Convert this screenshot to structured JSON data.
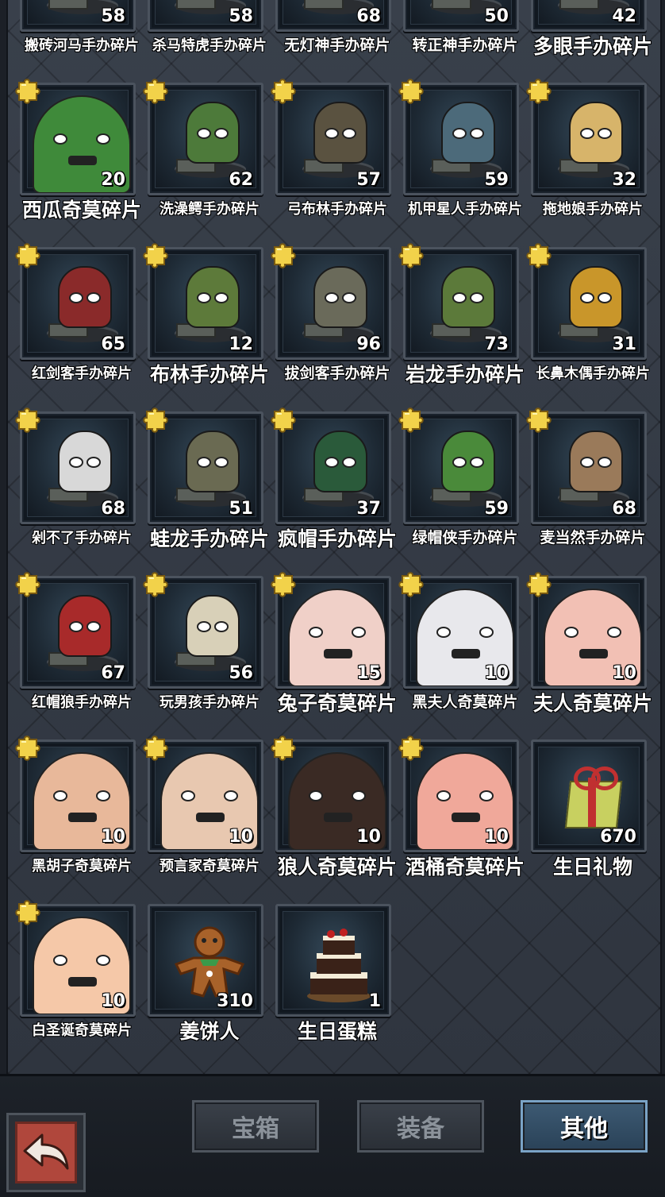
{
  "items": [
    {
      "label": "搬砖河马手办碎片",
      "count": "58",
      "puzzle": false,
      "type": "figure",
      "color": "#6a5a48",
      "size": "small"
    },
    {
      "label": "杀马特虎手办碎片",
      "count": "58",
      "puzzle": false,
      "type": "figure",
      "color": "#8b7d6a",
      "size": "small"
    },
    {
      "label": "无灯神手办碎片",
      "count": "68",
      "puzzle": false,
      "type": "figure",
      "color": "#4a6a8a",
      "size": "normal"
    },
    {
      "label": "转正神手办碎片",
      "count": "50",
      "puzzle": false,
      "type": "figure",
      "color": "#3d6f6a",
      "size": "normal"
    },
    {
      "label": "多眼手办碎片",
      "count": "42",
      "puzzle": false,
      "type": "figure",
      "color": "#8a4a4a",
      "size": "big"
    },
    {
      "label": "西瓜奇莫碎片",
      "count": "20",
      "puzzle": true,
      "type": "portrait",
      "color": "#3f8a3a",
      "size": "big"
    },
    {
      "label": "洗澡鳄手办碎片",
      "count": "62",
      "puzzle": true,
      "type": "figure",
      "color": "#4d7a3a",
      "size": "small"
    },
    {
      "label": "弓布林手办碎片",
      "count": "57",
      "puzzle": true,
      "type": "figure",
      "color": "#5a5240",
      "size": "small"
    },
    {
      "label": "机甲星人手办碎片",
      "count": "59",
      "puzzle": true,
      "type": "figure",
      "color": "#4c6a7a",
      "size": "small"
    },
    {
      "label": "拖地娘手办碎片",
      "count": "32",
      "puzzle": true,
      "type": "figure",
      "color": "#d7b46a",
      "size": "small"
    },
    {
      "label": "红剑客手办碎片",
      "count": "65",
      "puzzle": true,
      "type": "figure",
      "color": "#8a2a2a",
      "size": "small"
    },
    {
      "label": "布林手办碎片",
      "count": "12",
      "puzzle": true,
      "type": "figure",
      "color": "#5d7a3a",
      "size": "big"
    },
    {
      "label": "拔剑客手办碎片",
      "count": "96",
      "puzzle": true,
      "type": "figure",
      "color": "#6a6a5a",
      "size": "normal"
    },
    {
      "label": "岩龙手办碎片",
      "count": "73",
      "puzzle": true,
      "type": "figure",
      "color": "#5c7a3a",
      "size": "big"
    },
    {
      "label": "长鼻木偶手办碎片",
      "count": "31",
      "puzzle": true,
      "type": "figure",
      "color": "#c9962a",
      "size": "small"
    },
    {
      "label": "剁不了手办碎片",
      "count": "68",
      "puzzle": true,
      "type": "figure",
      "color": "#d8d8d8",
      "size": "small"
    },
    {
      "label": "蛙龙手办碎片",
      "count": "51",
      "puzzle": true,
      "type": "figure",
      "color": "#6a6a52",
      "size": "big"
    },
    {
      "label": "疯帽手办碎片",
      "count": "37",
      "puzzle": true,
      "type": "figure",
      "color": "#2a5a3a",
      "size": "big"
    },
    {
      "label": "绿帽侠手办碎片",
      "count": "59",
      "puzzle": true,
      "type": "figure",
      "color": "#4a8a3a",
      "size": "normal"
    },
    {
      "label": "麦当然手办碎片",
      "count": "68",
      "puzzle": true,
      "type": "figure",
      "color": "#9a7a5a",
      "size": "normal"
    },
    {
      "label": "红帽狼手办碎片",
      "count": "67",
      "puzzle": true,
      "type": "figure",
      "color": "#a82a2a",
      "size": "small"
    },
    {
      "label": "玩男孩手办碎片",
      "count": "56",
      "puzzle": true,
      "type": "figure",
      "color": "#d8d0b8",
      "size": "small"
    },
    {
      "label": "兔子奇莫碎片",
      "count": "15",
      "puzzle": true,
      "type": "portrait",
      "color": "#f0d0c8",
      "size": "big"
    },
    {
      "label": "黑夫人奇莫碎片",
      "count": "10",
      "puzzle": true,
      "type": "portrait",
      "color": "#e8e8ec",
      "size": "normal"
    },
    {
      "label": "夫人奇莫碎片",
      "count": "10",
      "puzzle": true,
      "type": "portrait",
      "color": "#f2c0b4",
      "size": "big"
    },
    {
      "label": "黑胡子奇莫碎片",
      "count": "10",
      "puzzle": true,
      "type": "portrait",
      "color": "#e8b89a",
      "size": "small"
    },
    {
      "label": "预言家奇莫碎片",
      "count": "10",
      "puzzle": true,
      "type": "portrait",
      "color": "#e8c8b0",
      "size": "small"
    },
    {
      "label": "狼人奇莫碎片",
      "count": "10",
      "puzzle": true,
      "type": "portrait",
      "color": "#3a2a24",
      "size": "big"
    },
    {
      "label": "酒桶奇莫碎片",
      "count": "10",
      "puzzle": true,
      "type": "portrait",
      "color": "#f0a89a",
      "size": "big"
    },
    {
      "label": "生日礼物",
      "count": "670",
      "puzzle": false,
      "type": "gift",
      "color": "#c8d060",
      "size": "big"
    },
    {
      "label": "白圣诞奇莫碎片",
      "count": "10",
      "puzzle": true,
      "type": "portrait",
      "color": "#f5c8a8",
      "size": "small"
    },
    {
      "label": "姜饼人",
      "count": "310",
      "puzzle": false,
      "type": "cookie",
      "color": "#a8622a",
      "size": "big"
    },
    {
      "label": "生日蛋糕",
      "count": "1",
      "puzzle": false,
      "type": "cake",
      "color": "#f4ecd8",
      "size": "big"
    }
  ],
  "tabs": {
    "chest": "宝箱",
    "equipment": "装备",
    "other": "其他"
  },
  "active_tab": "other"
}
